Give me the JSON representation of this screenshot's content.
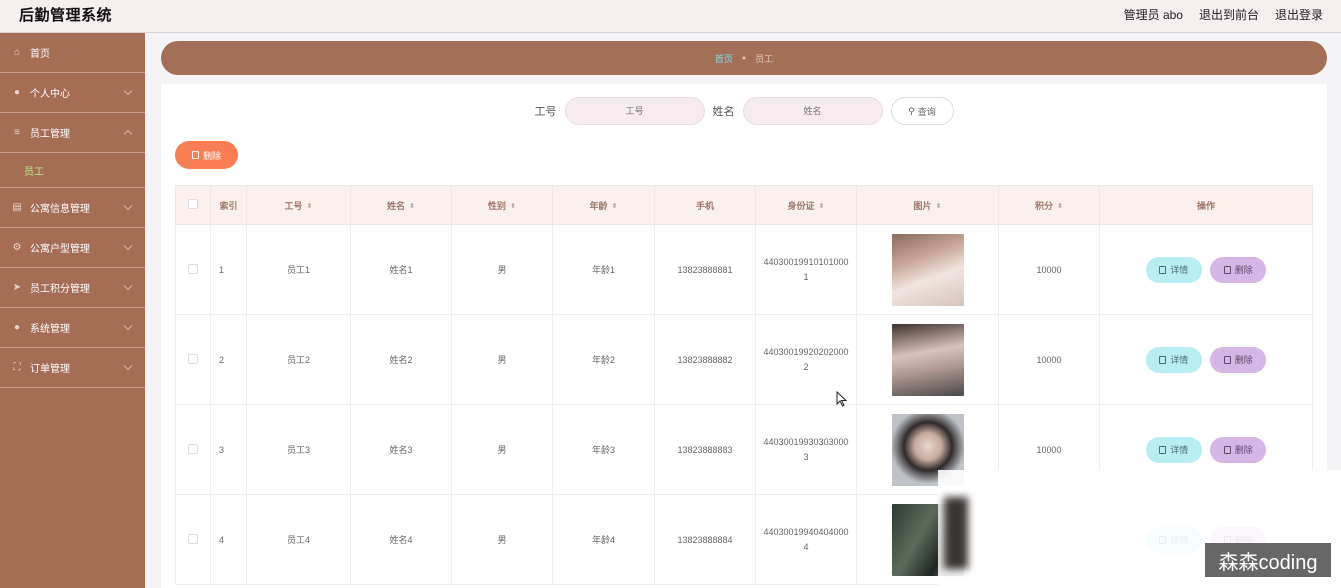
{
  "header": {
    "title": "后勤管理系统",
    "user_label": "管理员 abo",
    "back_label": "退出到前台",
    "logout_label": "退出登录"
  },
  "sidebar": {
    "items": [
      {
        "label": "首页",
        "icon": "home-icon"
      },
      {
        "label": "个人中心",
        "icon": "user-icon"
      },
      {
        "label": "员工管理",
        "icon": "list-icon",
        "expanded": true,
        "sub": [
          "员工"
        ]
      },
      {
        "label": "公寓信息管理",
        "icon": "clipboard-icon"
      },
      {
        "label": "公寓户型管理",
        "icon": "gear-icon"
      },
      {
        "label": "员工积分管理",
        "icon": "send-icon"
      },
      {
        "label": "系统管理",
        "icon": "user-icon"
      },
      {
        "label": "订单管理",
        "icon": "frame-icon"
      }
    ]
  },
  "breadcrumb": {
    "home": "首页",
    "current": "员工"
  },
  "search": {
    "field1_label": "工号",
    "field1_placeholder": "工号",
    "field2_label": "姓名",
    "field2_placeholder": "姓名",
    "button_label": "查询"
  },
  "toolbar": {
    "delete_label": "删除"
  },
  "table": {
    "columns": [
      "索引",
      "工号",
      "姓名",
      "性别",
      "年龄",
      "手机",
      "身份证",
      "图片",
      "积分",
      "操作"
    ],
    "rows": [
      {
        "index": "1",
        "id": "员工1",
        "name": "姓名1",
        "gender": "男",
        "age": "年龄1",
        "phone": "13823888881",
        "idcard": "440300199101010001",
        "points": "10000"
      },
      {
        "index": "2",
        "id": "员工2",
        "name": "姓名2",
        "gender": "男",
        "age": "年龄2",
        "phone": "13823888882",
        "idcard": "440300199202020002",
        "points": "10000"
      },
      {
        "index": "3",
        "id": "员工3",
        "name": "姓名3",
        "gender": "男",
        "age": "年龄3",
        "phone": "13823888883",
        "idcard": "440300199303030003",
        "points": "10000"
      },
      {
        "index": "4",
        "id": "员工4",
        "name": "姓名4",
        "gender": "男",
        "age": "年龄4",
        "phone": "13823888884",
        "idcard": "440300199404040004",
        "points": ""
      }
    ],
    "detail_label": "详情",
    "delete_label": "删除"
  },
  "watermark": "森森coding",
  "colors": {
    "sidebar": "#a66d55",
    "breadcrumb": "#a36f57",
    "delete_button": "#f97e53",
    "detail_button": "#b8eef3",
    "row_delete_button": "#d6b6e6",
    "submenu_active": "#b7f08a"
  }
}
